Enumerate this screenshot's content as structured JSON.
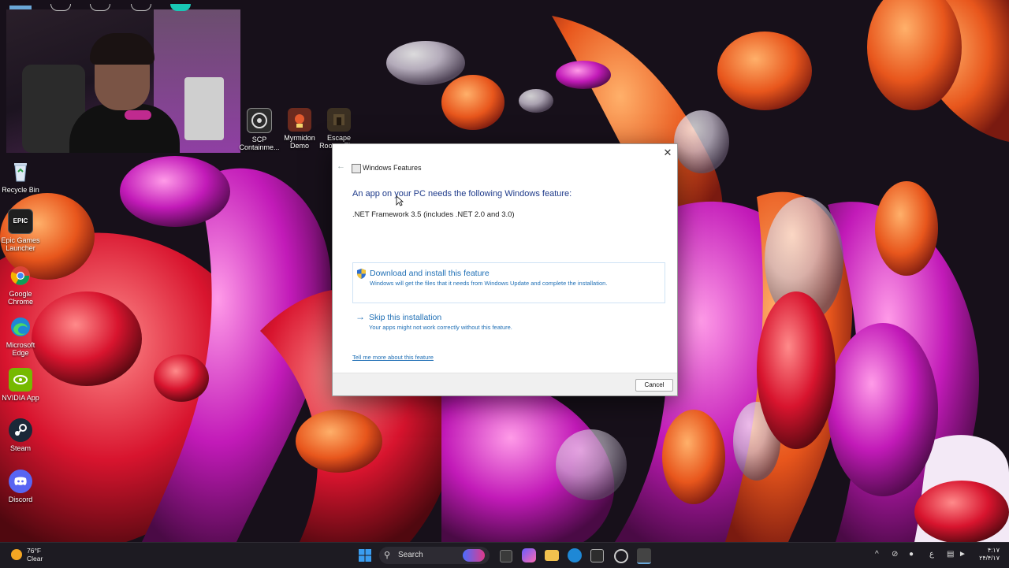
{
  "desktop": {
    "icons": [
      {
        "label": "Recycle Bin"
      },
      {
        "label": "Epic Games Launcher",
        "glyph": "EPIC"
      },
      {
        "label": "Google Chrome"
      },
      {
        "label": "Microsoft Edge"
      },
      {
        "label": "NVIDIA App"
      },
      {
        "label": "Steam"
      },
      {
        "label": "Discord"
      }
    ],
    "top_icons": [
      {
        "label": "SCP Containme..."
      },
      {
        "label": "Myrmidon Demo"
      },
      {
        "label": "Escape Room - Th..."
      }
    ]
  },
  "dialog": {
    "title": "Windows Features",
    "heading": "An app on your PC needs the following Windows feature:",
    "feature": ".NET Framework 3.5 (includes .NET 2.0 and 3.0)",
    "option_download_title": "Download and install this feature",
    "option_download_desc": "Windows will get the files that it needs from Windows Update and complete the installation.",
    "option_skip_title": "Skip this installation",
    "option_skip_desc": "Your apps might not work correctly without this feature.",
    "link": "Tell me more about this feature",
    "cancel": "Cancel",
    "close_glyph": "✕",
    "back_glyph": "←"
  },
  "taskbar": {
    "weather_temp": "76°F",
    "weather_cond": "Clear",
    "search_placeholder": "Search",
    "clock_time": "۴:۱۷",
    "clock_date": "۲۴/۴/۱۷"
  },
  "colors": {
    "accent": "#1f6fb5",
    "heading": "#1e3a8a"
  }
}
